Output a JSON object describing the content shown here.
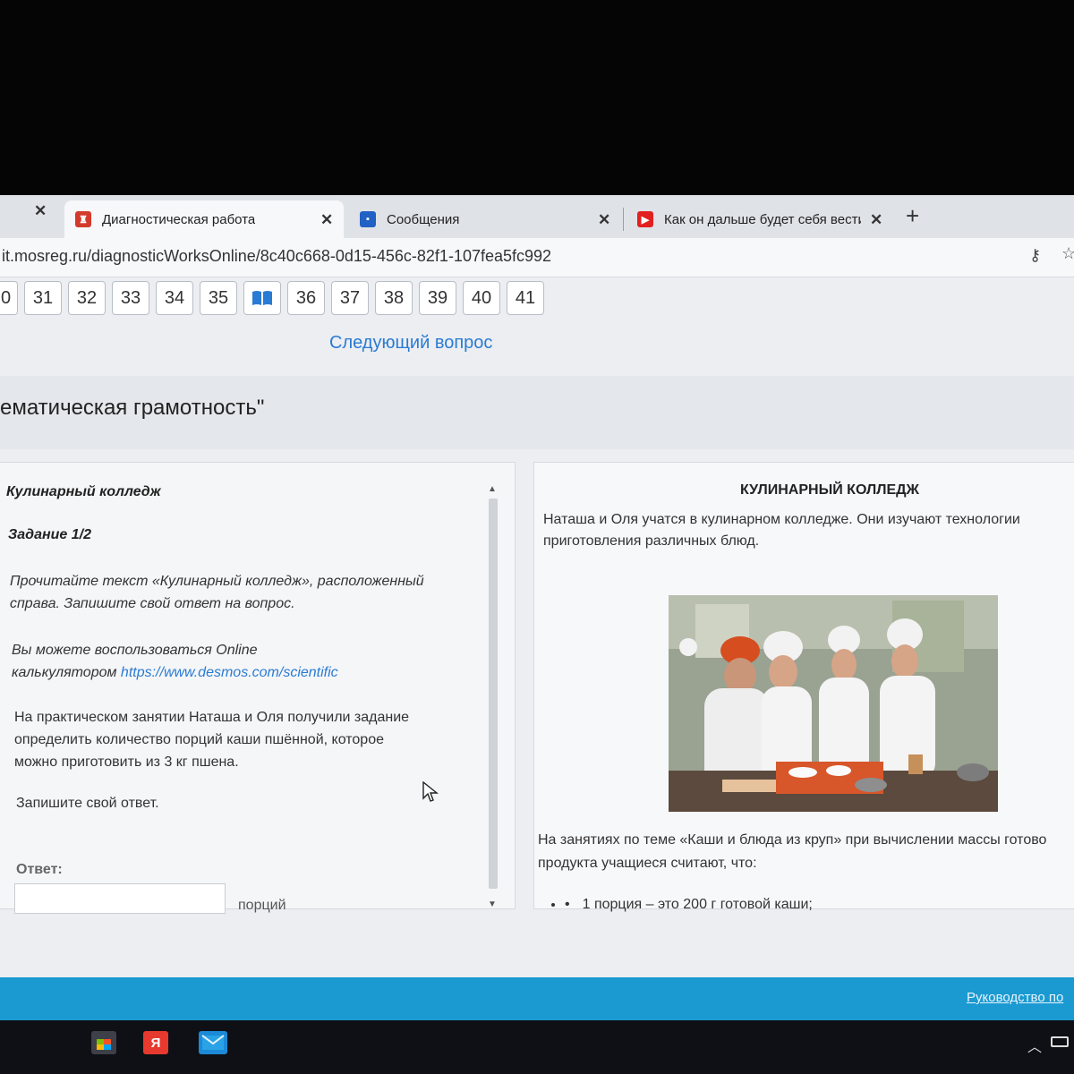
{
  "browser": {
    "tabs": [
      {
        "label": "Диагностическая работа",
        "icon": "gov-emblem-icon",
        "active": true
      },
      {
        "label": "Сообщения",
        "icon": "message-icon",
        "active": false
      },
      {
        "label": "Как он дальше будет себя вести",
        "icon": "youtube-icon",
        "active": false
      }
    ],
    "url": "it.mosreg.ru/diagnosticWorksOnline/8c40c668-0d15-456c-82f1-107fea5fc992"
  },
  "question_nav": {
    "partial_first": "0",
    "numbers_before": [
      "31",
      "32",
      "33",
      "34",
      "35"
    ],
    "numbers_after": [
      "36",
      "37",
      "38",
      "39",
      "40",
      "41"
    ],
    "next_label": "Следующий вопрос"
  },
  "section_title": "ематическая грамотность\"",
  "task": {
    "title": "Кулинарный колледж",
    "number": "Задание 1/2",
    "instruction_line1": "Прочитайте текст «Кулинарный колледж», расположенный",
    "instruction_line2": "справа. Запишите свой ответ на вопрос.",
    "calc_line1": "Вы можете воспользоваться Online",
    "calc_prefix": "калькулятором",
    "calc_link": "https://www.desmos.com/scientific",
    "problem_line1": "На практическом занятии Наташа и Оля получили задание",
    "problem_line2": "определить количество порций каши пшённой, которое",
    "problem_line3": "можно приготовить из 3 кг пшена.",
    "prompt": "Запишите свой ответ.",
    "answer_label": "Ответ:",
    "answer_value": "",
    "answer_unit": "порций"
  },
  "text_panel": {
    "title": "КУЛИНАРНЫЙ КОЛЛЕДЖ",
    "intro_line1": "Наташа и Оля учатся в кулинарном колледже. Они изучают технологии",
    "intro_line2": "приготовления различных блюд.",
    "lesson_line1": "На занятиях по теме «Каши и блюда из круп» при вычислении массы готово",
    "lesson_line2": "продукта учащиеся считают, что:",
    "bullet1": "1 порция – это 200 г готовой каши;"
  },
  "footer": {
    "link": "Руководство по"
  },
  "taskbar": {
    "icons": [
      "store-icon",
      "yandex-icon",
      "mail-icon"
    ],
    "yandex_letter": "Я"
  }
}
